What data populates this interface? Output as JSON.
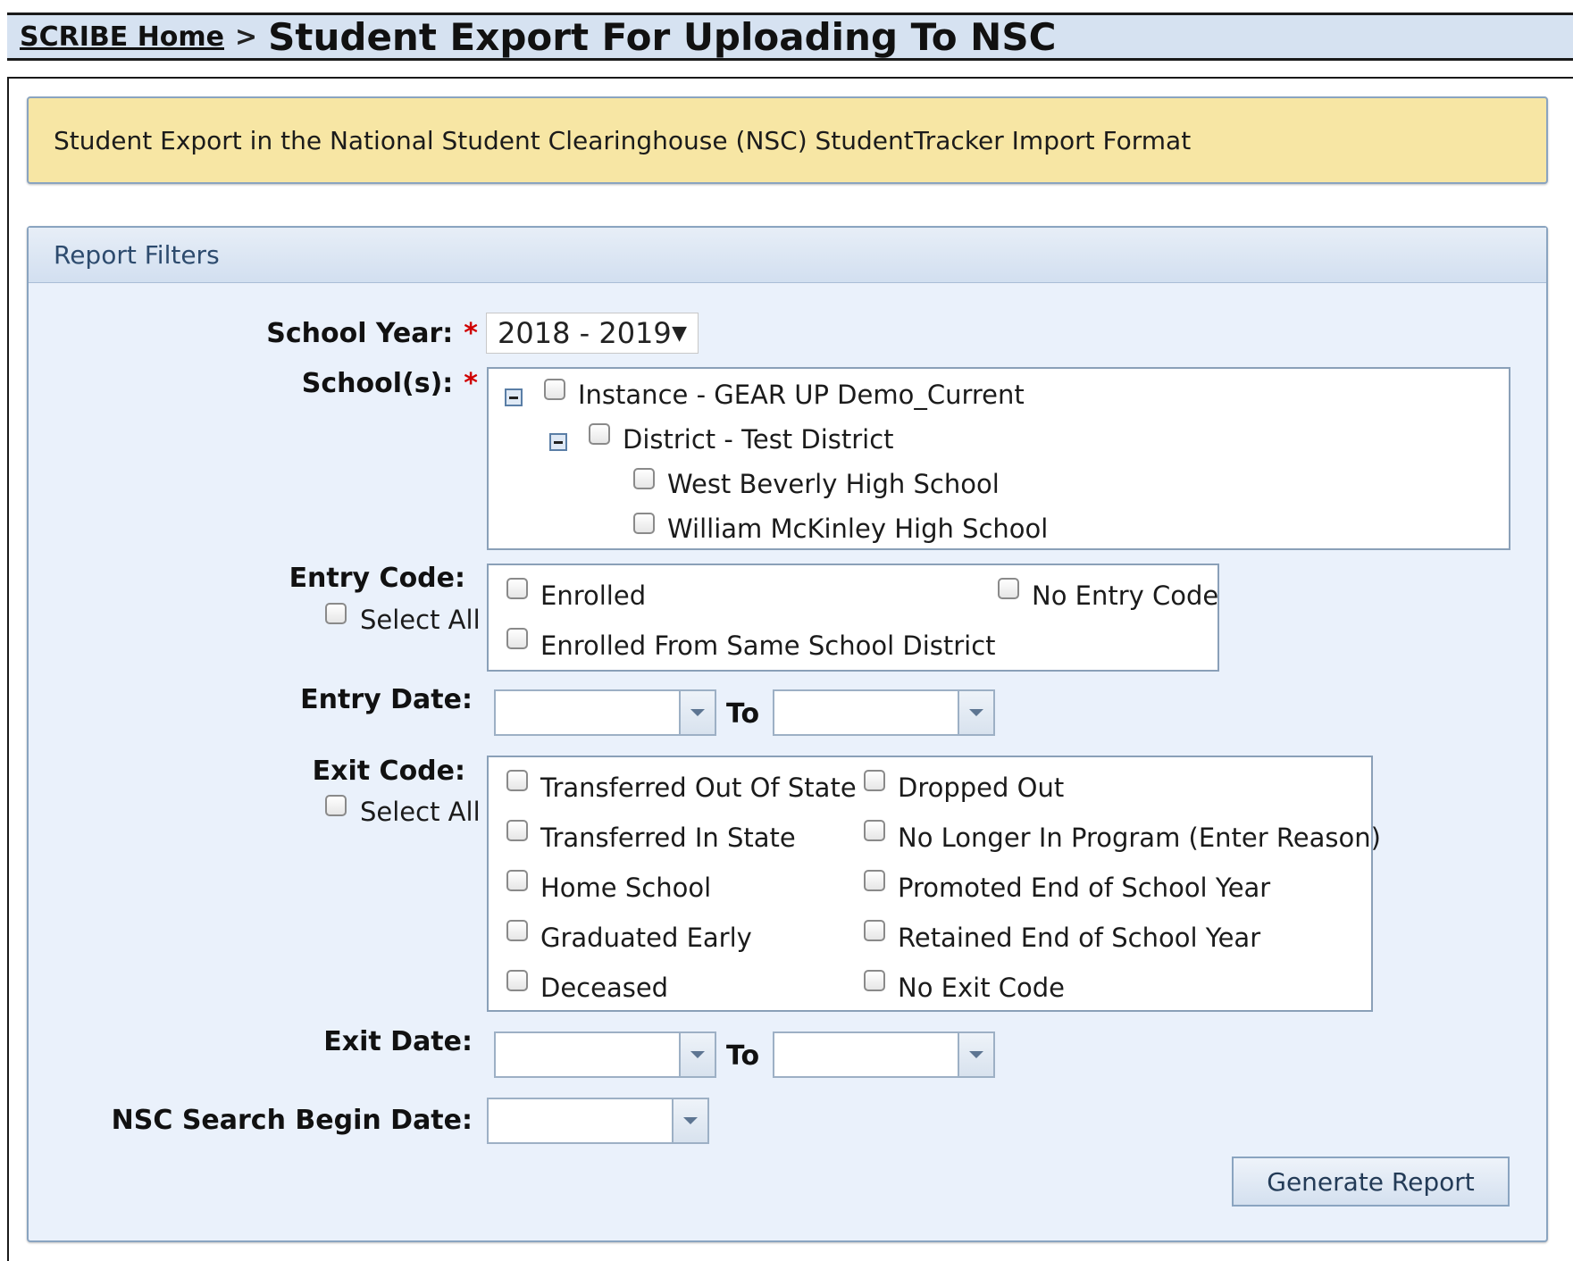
{
  "header": {
    "home_link": "SCRIBE Home",
    "separator": ">",
    "title": "Student Export For Uploading To NSC"
  },
  "banner": {
    "text": "Student Export in the National Student Clearinghouse (NSC) StudentTracker Import Format"
  },
  "filters": {
    "title": "Report Filters",
    "required_mark": "*",
    "school_year": {
      "label": "School Year:",
      "value": "2018 - 2019",
      "arrow": "▼"
    },
    "schools": {
      "label": "School(s):",
      "instance": "Instance - GEAR UP Demo_Current",
      "district": "District - Test District",
      "items": [
        "West Beverly High School",
        "William McKinley High School"
      ]
    },
    "entry_code": {
      "label": "Entry Code:",
      "select_all": "Select All",
      "options": [
        "Enrolled",
        "No Entry Code",
        "Enrolled From Same School District"
      ]
    },
    "entry_date": {
      "label": "Entry Date:",
      "to": "To"
    },
    "exit_code": {
      "label": "Exit Code:",
      "select_all": "Select All",
      "left": [
        "Transferred Out Of State",
        "Transferred In State",
        "Home School",
        "Graduated Early",
        "Deceased"
      ],
      "right": [
        "Dropped Out",
        "No Longer In Program (Enter Reason)",
        "Promoted End of School Year",
        "Retained End of School Year",
        "No Exit Code"
      ]
    },
    "exit_date": {
      "label": "Exit Date:",
      "to": "To"
    },
    "nsc_search": {
      "label": "NSC Search Begin Date:"
    },
    "generate_button": "Generate Report"
  }
}
